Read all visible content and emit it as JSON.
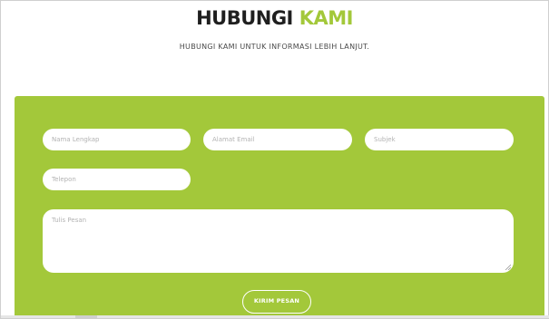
{
  "header": {
    "title_main": "HUBUNGI",
    "title_accent": "KAMI",
    "subtitle": "HUBUNGI KAMI UNTUK INFORMASI LEBIH LANJUT."
  },
  "form": {
    "name_placeholder": "Nama Lengkap",
    "email_placeholder": "Alamat Email",
    "subject_placeholder": "Subjek",
    "phone_placeholder": "Telepon",
    "message_placeholder": "Tulis Pesan",
    "submit_label": "KIRIM PESAN"
  },
  "colors": {
    "accent": "#a3c83a",
    "panel": "#a3c83a",
    "heading": "#1f1f1f",
    "field_bg": "#ffffff",
    "placeholder": "#b3b3b3"
  },
  "icons": {
    "textarea_resize": "resize-grip-icon"
  }
}
